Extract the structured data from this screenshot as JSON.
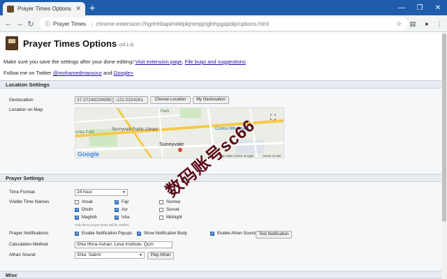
{
  "browser": {
    "tab_title": "Prayer Times Options",
    "tab_close": "✕",
    "new_tab": "+",
    "window_controls": [
      "—",
      "❐",
      "✕"
    ],
    "nav": [
      "←",
      "→",
      "↻"
    ],
    "omnibox": {
      "secure_icon": "ⓘ",
      "origin_label": "Prayer Times",
      "url": "chrome-extension://hgnhhbapimeklpkjmmpjnglnhpgapdip/options.html"
    },
    "toolbar_icons": [
      "☆",
      "▤",
      "●",
      "⋮"
    ]
  },
  "header": {
    "title": "Prayer Times Options",
    "version": "(v3.1.3)"
  },
  "notes": {
    "save_text": "Make sure you save the settings after your done editing!",
    "visit_link": "Visit extension page",
    "separator": ",",
    "bugs_link": "File bugs and suggestions",
    "follow_text": "Follow me on Twitter",
    "twitter_link": "@mohamedmansour",
    "and_text": "and",
    "gplus_link": "Google+"
  },
  "location": {
    "heading": "Location Settings",
    "geo_label": "Geolocation",
    "lat": "37.37248239999",
    "lng": "-122.0324261",
    "choose_btn": "Choose Location",
    "mygeo_btn": "My Geolocation",
    "map_label": "Location on Map",
    "map": {
      "labels": [
        "Park",
        "Sunnyvale Public Library",
        "Costco Wholesale",
        "Sunnyvale",
        "unita Park"
      ],
      "google": "Google",
      "attribution": "Map data ©2019 Google",
      "terms": "Terms of Use",
      "fullscreen": "⛶"
    }
  },
  "prayer": {
    "heading": "Prayer Settings",
    "time_format_label": "Time Format",
    "time_format_value": "24 hour",
    "visible_label": "Visible Time Names",
    "times": [
      {
        "name": "Imsak",
        "checked": false
      },
      {
        "name": "Fajr",
        "checked": true
      },
      {
        "name": "Sunrise",
        "checked": false
      },
      {
        "name": "Dhuhr",
        "checked": true
      },
      {
        "name": "Asr",
        "checked": true
      },
      {
        "name": "Sunset",
        "checked": false
      },
      {
        "name": "Maghrib",
        "checked": true
      },
      {
        "name": "Isha",
        "checked": true
      },
      {
        "name": "Midnight",
        "checked": false
      }
    ],
    "hint": "Only these prayer times will be notified.",
    "notifications_label": "Prayer Notifications",
    "notif_popups": "Enable Notification Popups",
    "notif_body": "Show Notification Body",
    "notif_athan": "Enable Athan Sound",
    "test_btn": "Test Notification",
    "calc_label": "Calculation Method",
    "calc_value": "Shia Ithna-Ashari, Leva Institute, Qum",
    "athan_label": "Athan Sound",
    "athan_value": "Shia: Salimi",
    "play_btn": "Play Athan"
  },
  "misc": {
    "heading": "Misc"
  },
  "watermark": "数码账号sc66",
  "colors": {
    "tabstrip": "#1f5dab",
    "link": "#1a0dab",
    "check": "#3a7fd5"
  }
}
